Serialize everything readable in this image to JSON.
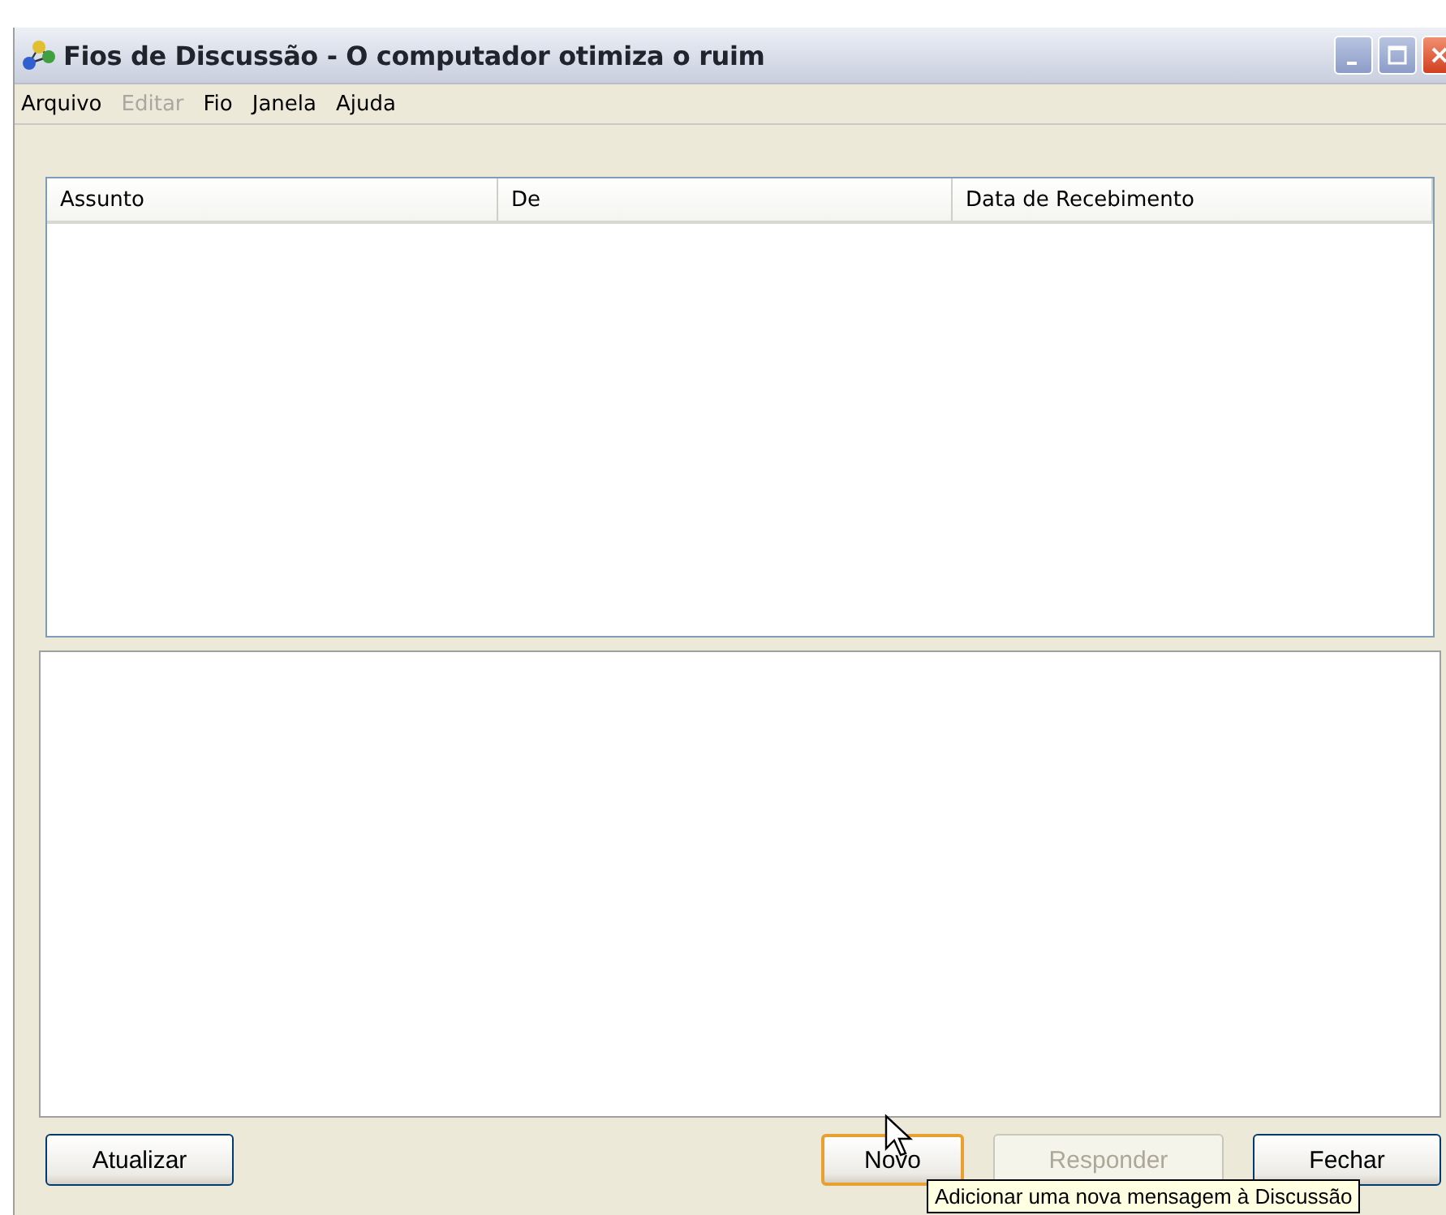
{
  "window": {
    "title": "Fios de Discussão - O computador otimiza o ruim"
  },
  "menu": [
    {
      "label": "Arquivo",
      "disabled": false
    },
    {
      "label": "Editar",
      "disabled": true
    },
    {
      "label": "Fio",
      "disabled": false
    },
    {
      "label": "Janela",
      "disabled": false
    },
    {
      "label": "Ajuda",
      "disabled": false
    }
  ],
  "table": {
    "columns": [
      "Assunto",
      "De",
      "Data de Recebimento"
    ]
  },
  "buttons": [
    {
      "label": "Atualizar",
      "disabled": false,
      "focused": false
    },
    {
      "label": "Novo",
      "disabled": false,
      "focused": true
    },
    {
      "label": "Responder",
      "disabled": true,
      "focused": false
    },
    {
      "label": "Fechar",
      "disabled": false,
      "focused": false
    }
  ],
  "tooltip": "Adicionar uma nova mensagem à Discussão"
}
